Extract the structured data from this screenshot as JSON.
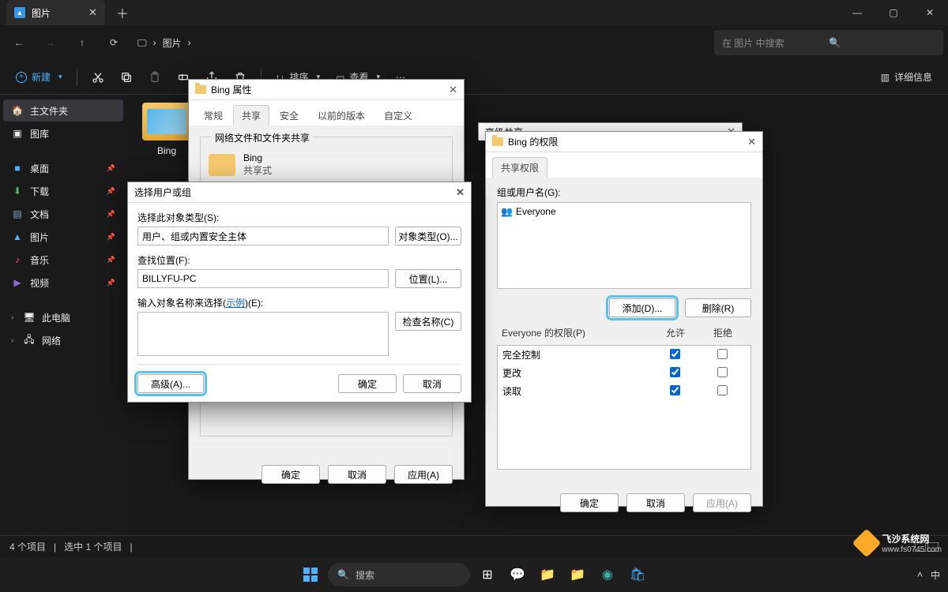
{
  "explorer": {
    "tab_title": "图片",
    "breadcrumb": [
      "图片"
    ],
    "search_placeholder": "在 图片 中搜索",
    "new_label": "新建",
    "sort_label": "排序",
    "view_label": "查看",
    "details_label": "详细信息",
    "sidebar": {
      "home": "主文件夹",
      "gallery": "图库",
      "desktop": "桌面",
      "downloads": "下载",
      "documents": "文档",
      "pictures": "图片",
      "music": "音乐",
      "videos": "视频",
      "this_pc": "此电脑",
      "network": "网络"
    },
    "folder_name": "Bing",
    "status_items": "4 个项目",
    "status_selected": "选中 1 个项目"
  },
  "properties": {
    "title": "Bing 属性",
    "tabs": {
      "general": "常规",
      "share": "共享",
      "security": "安全",
      "prev": "以前的版本",
      "custom": "自定义"
    },
    "section_title": "网络文件和文件夹共享",
    "folder_name": "Bing",
    "share_status": "共享式",
    "ok": "确定",
    "cancel": "取消",
    "apply": "应用(A)"
  },
  "advanced_share": {
    "title": "高级共享"
  },
  "select_user": {
    "title": "选择用户或组",
    "object_type_label": "选择此对象类型(S):",
    "object_type_value": "用户、组或内置安全主体",
    "object_type_btn": "对象类型(O)...",
    "location_label": "查找位置(F):",
    "location_value": "BILLYFU-PC",
    "location_btn": "位置(L)...",
    "enter_label_a": "输入对象名称来选择(",
    "enter_label_link": "示例",
    "enter_label_b": ")(E):",
    "check_btn": "检查名称(C)",
    "advanced_btn": "高级(A)...",
    "ok": "确定",
    "cancel": "取消"
  },
  "permissions": {
    "title": "Bing 的权限",
    "tab": "共享权限",
    "group_label": "组或用户名(G):",
    "everyone": "Everyone",
    "add_btn": "添加(D)...",
    "remove_btn": "删除(R)",
    "perm_for": "Everyone 的权限(P)",
    "allow": "允许",
    "deny": "拒绝",
    "rows": {
      "full": "完全控制",
      "change": "更改",
      "read": "读取"
    },
    "ok": "确定",
    "cancel": "取消",
    "apply": "应用(A)"
  },
  "taskbar": {
    "search": "搜索",
    "ime": "中"
  },
  "watermark": {
    "brand": "飞沙系统网",
    "url": "www.fs0745.com"
  }
}
